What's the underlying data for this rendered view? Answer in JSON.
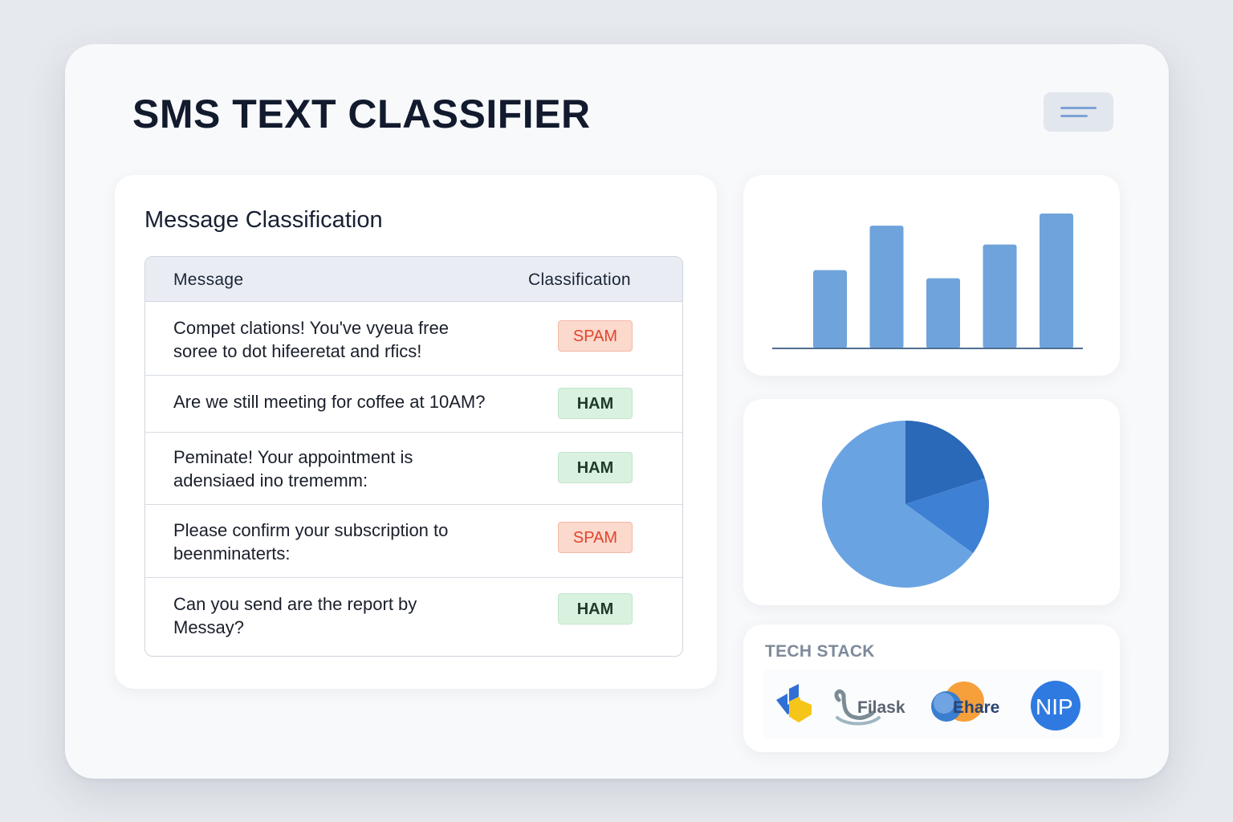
{
  "header": {
    "title": "SMS TEXT CLASSIFIER"
  },
  "classification": {
    "title": "Message Classification",
    "columns": {
      "message": "Message",
      "classification": "Classification"
    },
    "rows": [
      {
        "line1": "Compet clations! You've vyeua free",
        "line2": "soree to dot hifeeretat and rfics!",
        "label": "SPAM",
        "type": "spam"
      },
      {
        "line1": "Are we still meeting for coffee at 10AM?",
        "line2": "",
        "label": "HAM",
        "type": "ham"
      },
      {
        "line1": "Peminate! Your appointment is",
        "line2": "adensiaed ino trememm:",
        "label": "HAM",
        "type": "ham"
      },
      {
        "line1": "Please confirm your subscription to",
        "line2": "beenminaterts:",
        "label": "SPAM",
        "type": "spam"
      },
      {
        "line1": "Can you send are the report by",
        "line2": "Messay?",
        "label": "HAM",
        "type": "ham"
      }
    ]
  },
  "chart_data": [
    {
      "type": "bar",
      "categories": [
        "",
        "",
        "",
        "",
        ""
      ],
      "values": [
        58,
        91,
        52,
        77,
        100
      ],
      "ylim": [
        0,
        100
      ],
      "grid": false,
      "color": "#6fa3dc"
    },
    {
      "type": "pie",
      "values": [
        20,
        15,
        65
      ],
      "colors": [
        "#2a68b8",
        "#3d80d4",
        "#6aa3e2"
      ]
    }
  ],
  "tech_stack": {
    "title": "TECH STACK",
    "logos": [
      {
        "icon": "python-icon",
        "text": ""
      },
      {
        "icon": "flask-icon",
        "text": "Filask"
      },
      {
        "icon": "chare-icon",
        "text": "Ehare"
      },
      {
        "icon": "nlp-icon",
        "text": "NIP"
      }
    ]
  }
}
